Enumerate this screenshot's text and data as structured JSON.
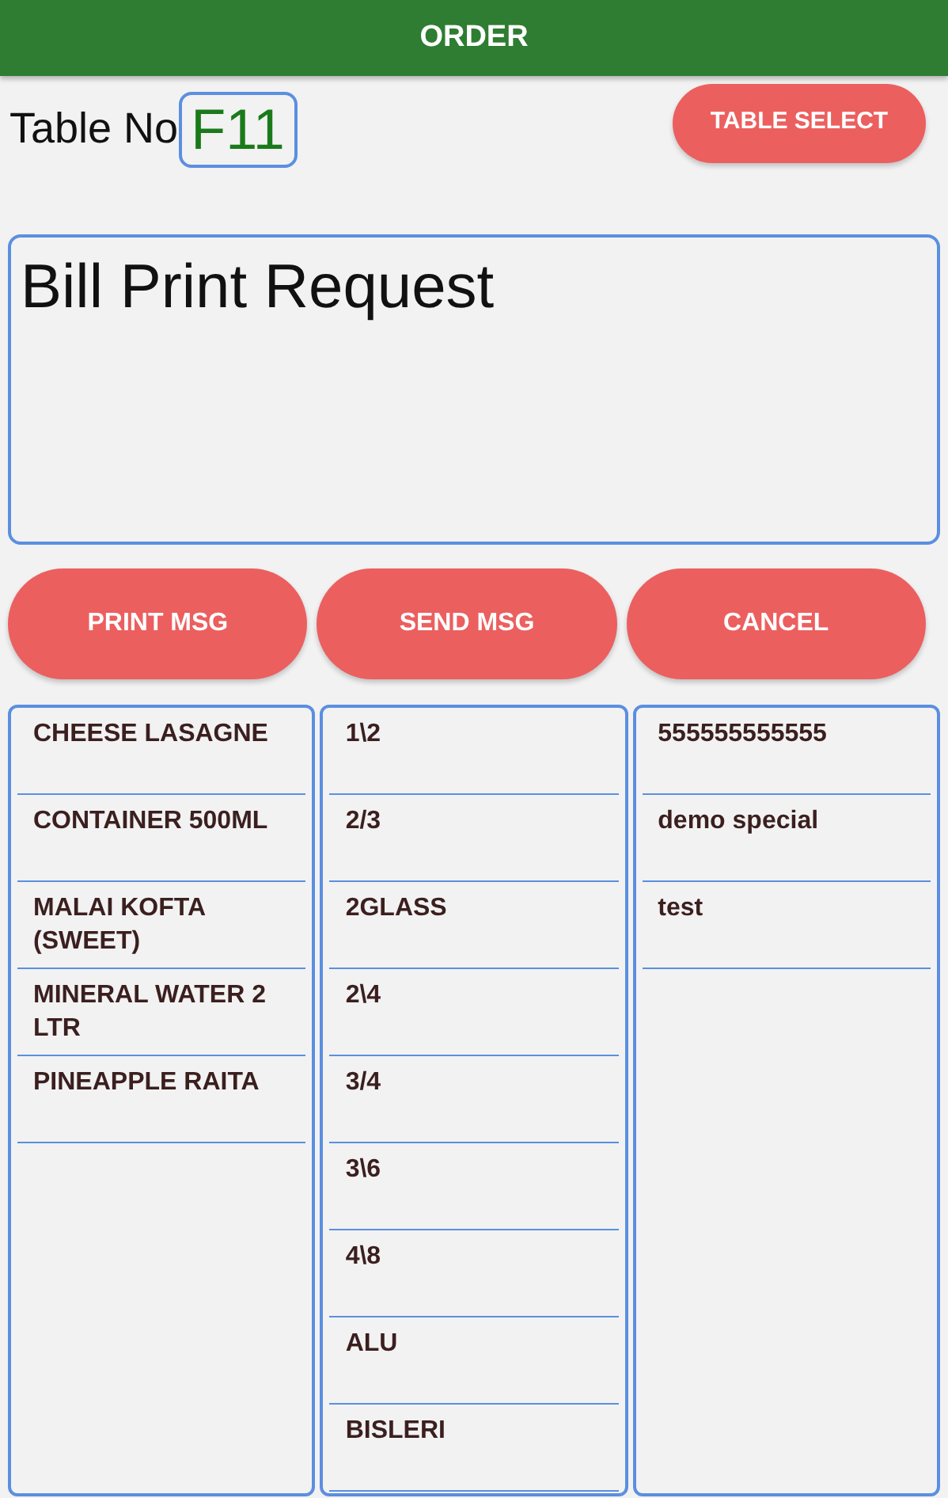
{
  "title": "ORDER",
  "table_label": "Table No",
  "table_value": "F11",
  "table_select_button": "TABLE SELECT",
  "message": {
    "value": "Bill Print Request"
  },
  "buttons": [
    "PRINT MSG",
    "SEND MSG",
    "CANCEL"
  ],
  "lists": [
    {
      "items": [
        "CHEESE LASAGNE",
        "CONTAINER 500ML",
        "MALAI KOFTA (SWEET)",
        "MINERAL WATER 2 LTR",
        "PINEAPPLE RAITA"
      ]
    },
    {
      "items": [
        "1\\2",
        "2/3",
        "2GLASS",
        "2\\4",
        "3/4",
        "3\\6",
        "4\\8",
        "ALU",
        "BISLERI"
      ]
    },
    {
      "items": [
        "555555555555",
        "demo special",
        "test"
      ]
    }
  ]
}
